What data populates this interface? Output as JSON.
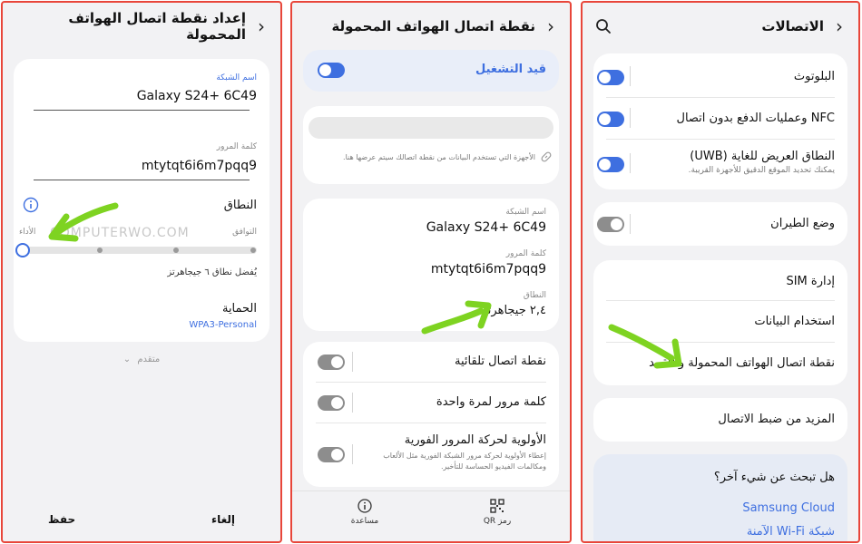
{
  "panel1": {
    "title": "إعداد نقطة اتصال الهواتف المحمولة",
    "network_name_label": "اسم الشبكة",
    "network_name_value": "Galaxy S24+ 6C49",
    "password_label": "كلمة المرور",
    "password_value": "mtytqt6i6m7pqq9",
    "band_label": "النطاق",
    "compat_label": "التوافق",
    "perf_label": "الأداء",
    "band_note": "يُفضل نطاق ٦ جيجاهرتز",
    "band_level_index": 0,
    "band_level_count": 4,
    "security_label": "الحماية",
    "security_value": "WPA3-Personal",
    "advanced_label": "متقدم",
    "watermark": "COMPUTERWO.COM",
    "save_label": "حفظ",
    "cancel_label": "إلغاء"
  },
  "panel2": {
    "title": "نقطة اتصال الهواتف المحمولة",
    "on_label": "قيد التشغيل",
    "connected_devices_note": "الأجهزة التي تستخدم البيانات من نقطة اتصالك سيتم عرضها هنا.",
    "network_name_label": "اسم الشبكة",
    "network_name_value": "Galaxy S24+ 6C49",
    "password_label": "كلمة المرور",
    "password_value": "mtytqt6i6m7pqq9",
    "band_label": "النطاق",
    "band_value": "٢,٤ جيجاهرتز",
    "auto_hotspot_label": "نقطة اتصال تلقائية",
    "one_time_password_label": "كلمة مرور لمرة واحدة",
    "priority_label": "الأولوية لحركة المرور الفورية",
    "priority_desc": "إعطاء الأولوية لحركة مرور الشبكة الفورية مثل الألعاب ومكالمات الفيديو الحساسة للتأخير.",
    "qr_label": "رمز QR",
    "help_label": "مساعدة"
  },
  "panel3": {
    "title": "الاتصالات",
    "bluetooth_label": "البلوتوث",
    "nfc_label": "NFC وعمليات الدفع بدون اتصال",
    "uwb_label": "النطاق العريض للغاية (UWB)",
    "uwb_desc": "يمكنك تحديد الموقع الدقيق للأجهزة القريبة.",
    "airplane_label": "وضع الطيران",
    "sim_label": "إدارة SIM",
    "data_usage_label": "استخدام البيانات",
    "hotspot_label": "نقطة اتصال الهواتف المحمولة والتقييد",
    "more_label": "المزيد من ضبط الاتصال",
    "looking_label": "هل تبحث عن شيء آخر؟",
    "samsung_cloud_label": "Samsung Cloud",
    "secure_wifi_label": "شبكة Wi-Fi الآمنة"
  },
  "colors": {
    "accent": "#3e6fe0",
    "frame": "#e8463a",
    "arrow": "#7ed321"
  }
}
